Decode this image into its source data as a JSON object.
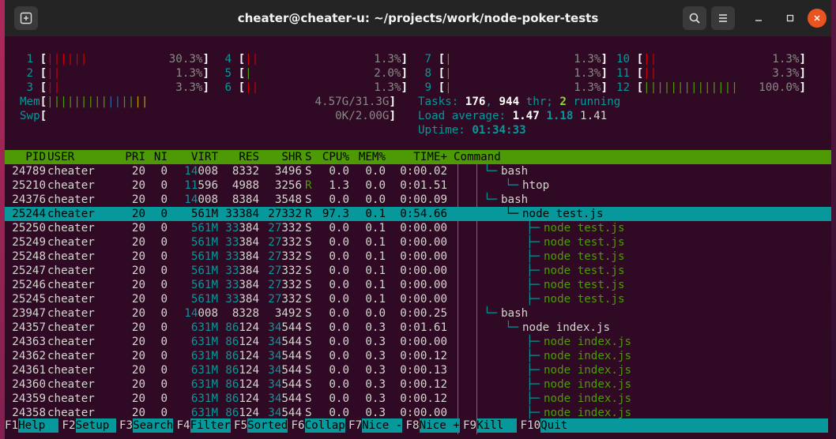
{
  "window": {
    "title": "cheater@cheater-u: ~/projects/work/node-poker-tests"
  },
  "icons": {
    "new_tab": "new-tab-icon",
    "search": "search-icon",
    "menu": "hamburger-menu-icon",
    "minimize": "minimize-icon",
    "maximize": "maximize-icon",
    "close": "close-icon"
  },
  "colors": {
    "cyan": "#06989a",
    "green": "#4e9a06",
    "red": "#cc0000",
    "bg": "#300a24",
    "close_btn": "#e95420"
  },
  "cpu_meters": [
    {
      "id": "1",
      "bar": "||||||",
      "pct": "30.3%",
      "color": "red"
    },
    {
      "id": "2",
      "bar": "||",
      "pct": "1.3%",
      "color": "red"
    },
    {
      "id": "3",
      "bar": "||",
      "pct": "3.3%",
      "color": "red"
    },
    {
      "id": "4",
      "bar": "||",
      "pct": "1.3%",
      "color": "red"
    },
    {
      "id": "5",
      "bar": "|",
      "pct": "2.0%",
      "color": "green"
    },
    {
      "id": "6",
      "bar": "||",
      "pct": "1.3%",
      "color": "red"
    },
    {
      "id": "7",
      "bar": "|",
      "pct": "1.3%",
      "color": "green"
    },
    {
      "id": "8",
      "bar": "|",
      "pct": "1.3%",
      "color": "green"
    },
    {
      "id": "9",
      "bar": "|",
      "pct": "1.3%",
      "color": "green"
    },
    {
      "id": "10",
      "bar": "||",
      "pct": "1.3%",
      "color": "red"
    },
    {
      "id": "11",
      "bar": "||",
      "pct": "3.3%",
      "color": "red"
    },
    {
      "id": "12",
      "bar": "||||||||||||||",
      "pct": "100.0%",
      "color": "green"
    }
  ],
  "mem": {
    "label": "Mem",
    "bar": "|||||||||||||||",
    "value": "4.57G/31.3G"
  },
  "swp": {
    "label": "Swp",
    "bar": "",
    "value": "0K/2.00G"
  },
  "tasks": {
    "label": "Tasks:",
    "count": "176",
    "threads": "944",
    "thr_label": "thr;",
    "running": "2",
    "running_label": "running"
  },
  "load": {
    "label": "Load average:",
    "v1": "1.47",
    "v5": "1.18",
    "v15": "1.41"
  },
  "uptime": {
    "label": "Uptime:",
    "value": "01:34:33"
  },
  "columns": [
    "PID",
    "USER",
    "PRI",
    "NI",
    "VIRT",
    "RES",
    "SHR",
    "S",
    "CPU%",
    "MEM%",
    "TIME+",
    "Command"
  ],
  "processes": [
    {
      "pid": "24789",
      "user": "cheater",
      "pri": "20",
      "ni": "0",
      "virt": "14008",
      "res": "8332",
      "shr": "3496",
      "s": "S",
      "cpu": "0.0",
      "mem": "0.0",
      "time": "0:00.02",
      "cmd": "bash",
      "indent": 0,
      "child": false
    },
    {
      "pid": "25210",
      "user": "cheater",
      "pri": "20",
      "ni": "0",
      "virt": "11596",
      "res": "4988",
      "shr": "3256",
      "s": "R",
      "cpu": "1.3",
      "mem": "0.0",
      "time": "0:01.51",
      "cmd": "htop",
      "indent": 1,
      "child": false
    },
    {
      "pid": "24376",
      "user": "cheater",
      "pri": "20",
      "ni": "0",
      "virt": "14008",
      "res": "8384",
      "shr": "3548",
      "s": "S",
      "cpu": "0.0",
      "mem": "0.0",
      "time": "0:00.09",
      "cmd": "bash",
      "indent": 0,
      "child": false
    },
    {
      "pid": "25244",
      "user": "cheater",
      "pri": "20",
      "ni": "0",
      "virt": "561M",
      "res": "33384",
      "shr": "27332",
      "s": "R",
      "cpu": "97.3",
      "mem": "0.1",
      "time": "0:54.66",
      "cmd": "node test.js",
      "indent": 1,
      "child": false,
      "selected": true
    },
    {
      "pid": "25250",
      "user": "cheater",
      "pri": "20",
      "ni": "0",
      "virt": "561M",
      "res": "33384",
      "shr": "27332",
      "s": "S",
      "cpu": "0.0",
      "mem": "0.1",
      "time": "0:00.00",
      "cmd": "node test.js",
      "indent": 2,
      "child": true
    },
    {
      "pid": "25249",
      "user": "cheater",
      "pri": "20",
      "ni": "0",
      "virt": "561M",
      "res": "33384",
      "shr": "27332",
      "s": "S",
      "cpu": "0.0",
      "mem": "0.1",
      "time": "0:00.00",
      "cmd": "node test.js",
      "indent": 2,
      "child": true
    },
    {
      "pid": "25248",
      "user": "cheater",
      "pri": "20",
      "ni": "0",
      "virt": "561M",
      "res": "33384",
      "shr": "27332",
      "s": "S",
      "cpu": "0.0",
      "mem": "0.1",
      "time": "0:00.00",
      "cmd": "node test.js",
      "indent": 2,
      "child": true
    },
    {
      "pid": "25247",
      "user": "cheater",
      "pri": "20",
      "ni": "0",
      "virt": "561M",
      "res": "33384",
      "shr": "27332",
      "s": "S",
      "cpu": "0.0",
      "mem": "0.1",
      "time": "0:00.00",
      "cmd": "node test.js",
      "indent": 2,
      "child": true
    },
    {
      "pid": "25246",
      "user": "cheater",
      "pri": "20",
      "ni": "0",
      "virt": "561M",
      "res": "33384",
      "shr": "27332",
      "s": "S",
      "cpu": "0.0",
      "mem": "0.1",
      "time": "0:00.00",
      "cmd": "node test.js",
      "indent": 2,
      "child": true
    },
    {
      "pid": "25245",
      "user": "cheater",
      "pri": "20",
      "ni": "0",
      "virt": "561M",
      "res": "33384",
      "shr": "27332",
      "s": "S",
      "cpu": "0.0",
      "mem": "0.1",
      "time": "0:00.00",
      "cmd": "node test.js",
      "indent": 2,
      "child": true
    },
    {
      "pid": "23947",
      "user": "cheater",
      "pri": "20",
      "ni": "0",
      "virt": "14008",
      "res": "8328",
      "shr": "3492",
      "s": "S",
      "cpu": "0.0",
      "mem": "0.0",
      "time": "0:00.25",
      "cmd": "bash",
      "indent": 0,
      "child": false
    },
    {
      "pid": "24357",
      "user": "cheater",
      "pri": "20",
      "ni": "0",
      "virt": "631M",
      "res": "86124",
      "shr": "34544",
      "s": "S",
      "cpu": "0.0",
      "mem": "0.3",
      "time": "0:01.61",
      "cmd": "node index.js",
      "indent": 1,
      "child": false
    },
    {
      "pid": "24363",
      "user": "cheater",
      "pri": "20",
      "ni": "0",
      "virt": "631M",
      "res": "86124",
      "shr": "34544",
      "s": "S",
      "cpu": "0.0",
      "mem": "0.3",
      "time": "0:00.00",
      "cmd": "node index.js",
      "indent": 2,
      "child": true
    },
    {
      "pid": "24362",
      "user": "cheater",
      "pri": "20",
      "ni": "0",
      "virt": "631M",
      "res": "86124",
      "shr": "34544",
      "s": "S",
      "cpu": "0.0",
      "mem": "0.3",
      "time": "0:00.12",
      "cmd": "node index.js",
      "indent": 2,
      "child": true
    },
    {
      "pid": "24361",
      "user": "cheater",
      "pri": "20",
      "ni": "0",
      "virt": "631M",
      "res": "86124",
      "shr": "34544",
      "s": "S",
      "cpu": "0.0",
      "mem": "0.3",
      "time": "0:00.13",
      "cmd": "node index.js",
      "indent": 2,
      "child": true
    },
    {
      "pid": "24360",
      "user": "cheater",
      "pri": "20",
      "ni": "0",
      "virt": "631M",
      "res": "86124",
      "shr": "34544",
      "s": "S",
      "cpu": "0.0",
      "mem": "0.3",
      "time": "0:00.12",
      "cmd": "node index.js",
      "indent": 2,
      "child": true
    },
    {
      "pid": "24359",
      "user": "cheater",
      "pri": "20",
      "ni": "0",
      "virt": "631M",
      "res": "86124",
      "shr": "34544",
      "s": "S",
      "cpu": "0.0",
      "mem": "0.3",
      "time": "0:00.12",
      "cmd": "node index.js",
      "indent": 2,
      "child": true
    },
    {
      "pid": "24358",
      "user": "cheater",
      "pri": "20",
      "ni": "0",
      "virt": "631M",
      "res": "86124",
      "shr": "34544",
      "s": "S",
      "cpu": "0.0",
      "mem": "0.3",
      "time": "0:00.00",
      "cmd": "node index.js",
      "indent": 2,
      "child": true
    }
  ],
  "function_keys": [
    {
      "key": "F1",
      "label": "Help  "
    },
    {
      "key": "F2",
      "label": "Setup "
    },
    {
      "key": "F3",
      "label": "Search"
    },
    {
      "key": "F4",
      "label": "Filter"
    },
    {
      "key": "F5",
      "label": "Sorted"
    },
    {
      "key": "F6",
      "label": "Collap"
    },
    {
      "key": "F7",
      "label": "Nice -"
    },
    {
      "key": "F8",
      "label": "Nice +"
    },
    {
      "key": "F9",
      "label": "Kill  "
    },
    {
      "key": "F10",
      "label": "Quit"
    }
  ]
}
